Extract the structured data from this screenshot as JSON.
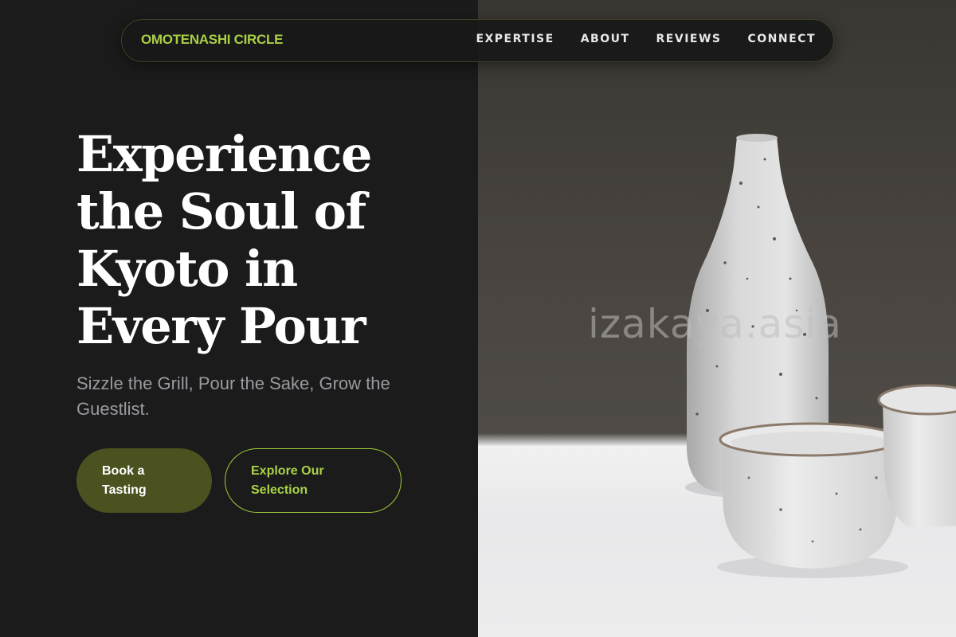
{
  "brand": "OMOTENASHI CIRCLE",
  "nav": [
    "EXPERTISE",
    "ABOUT",
    "REVIEWS",
    "CONNECT"
  ],
  "hero": {
    "headline": "Experience the Soul of Kyoto in Every Pour",
    "subheadline": "Sizzle the Grill, Pour the Sake, Grow the Guestlist.",
    "primary_button": "Book a Tasting",
    "secondary_button": "Explore Our Selection"
  },
  "watermark": "izakaya.asia",
  "colors": {
    "accent": "#a9cf45",
    "primary_button_bg": "#4b5220",
    "background": "#1b1b1b"
  }
}
